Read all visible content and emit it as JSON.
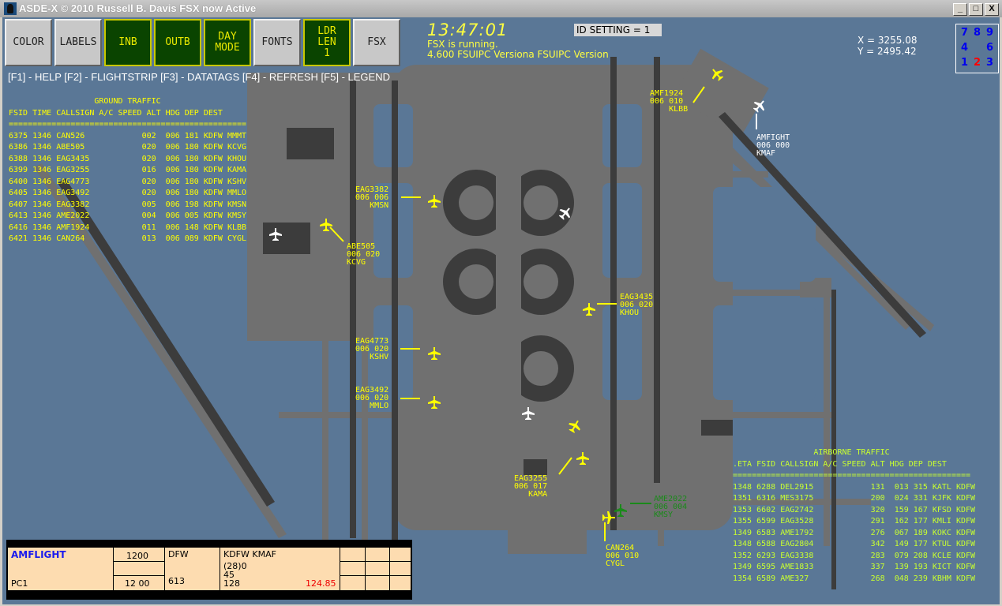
{
  "window": {
    "title": "ASDE-X © 2010 Russell B. Davis  FSX now Active",
    "controls": [
      "_",
      "□",
      "X"
    ]
  },
  "toolbar": {
    "buttons": [
      {
        "label": "COLOR",
        "style": "gray"
      },
      {
        "label": "LABELS",
        "style": "gray"
      },
      {
        "label": "INB",
        "style": "green"
      },
      {
        "label": "OUTB",
        "style": "green"
      },
      {
        "label": "DAY\nMODE",
        "style": "green"
      },
      {
        "label": "FONTS",
        "style": "gray"
      },
      {
        "label": "LDR\nLEN\n1",
        "style": "green"
      },
      {
        "label": "FSX",
        "style": "gray"
      }
    ]
  },
  "help_line": "[F1] - HELP [F2] - FLIGHTSTRIP [F3] - DATATAGS [F4] - REFRESH [F5] - LEGEND",
  "status": {
    "clock": "13:47:01",
    "fsx_running": "FSX is running.",
    "fsuipc_version": "4.600 FSUIPC Versiona FSUIPC Version",
    "id_setting": "ID SETTING = 1",
    "x_coord": "X = 3255.08",
    "y_coord": "Y = 2495.42"
  },
  "numpad": {
    "rows": [
      [
        "7",
        "8",
        "9"
      ],
      [
        "4",
        "",
        "6"
      ],
      [
        "1",
        "2",
        "3"
      ]
    ],
    "active": "2",
    "colors": {
      "normal": "#0000ee",
      "active": "#ff0000"
    }
  },
  "ground_traffic": {
    "title": "GROUND TRAFFIC",
    "columns": [
      "FSID",
      "TIME",
      "CALLSIGN",
      "A/C",
      "SPEED",
      "ALT",
      "HDG",
      "DEP",
      "DEST"
    ],
    "separator": "==================================================",
    "rows": [
      [
        "6375",
        "1346",
        "CAN526",
        "",
        "002",
        "006",
        "181",
        "KDFW",
        "MMMT"
      ],
      [
        "6386",
        "1346",
        "ABE505",
        "",
        "020",
        "006",
        "180",
        "KDFW",
        "KCVG"
      ],
      [
        "6388",
        "1346",
        "EAG3435",
        "",
        "020",
        "006",
        "180",
        "KDFW",
        "KHOU"
      ],
      [
        "6399",
        "1346",
        "EAG3255",
        "",
        "016",
        "006",
        "180",
        "KDFW",
        "KAMA"
      ],
      [
        "6400",
        "1346",
        "EAG4773",
        "",
        "020",
        "006",
        "180",
        "KDFW",
        "KSHV"
      ],
      [
        "6405",
        "1346",
        "EAG3492",
        "",
        "020",
        "006",
        "180",
        "KDFW",
        "MMLO"
      ],
      [
        "6407",
        "1346",
        "EAG3382",
        "",
        "005",
        "006",
        "198",
        "KDFW",
        "KMSN"
      ],
      [
        "6413",
        "1346",
        "AME2022",
        "",
        "004",
        "006",
        "005",
        "KDFW",
        "KMSY"
      ],
      [
        "6416",
        "1346",
        "AMF1924",
        "",
        "011",
        "006",
        "148",
        "KDFW",
        "KLBB"
      ],
      [
        "6421",
        "1346",
        "CAN264",
        "",
        "013",
        "006",
        "089",
        "KDFW",
        "CYGL"
      ]
    ]
  },
  "airborne_traffic": {
    "title": "AIRBORNE TRAFFIC",
    "columns": [
      ".ETA",
      "FSID",
      "CALLSIGN",
      "A/C",
      "SPEED",
      "ALT",
      "HDG",
      "DEP",
      "DEST"
    ],
    "separator": "==================================================",
    "rows": [
      [
        "1348",
        "6288",
        "DEL2915",
        "",
        "131",
        "013",
        "315",
        "KATL",
        "KDFW"
      ],
      [
        "1351",
        "6316",
        "MES3175",
        "",
        "200",
        "024",
        "331",
        "KJFK",
        "KDFW"
      ],
      [
        "1353",
        "6602",
        "EAG2742",
        "",
        "320",
        "159",
        "167",
        "KFSD",
        "KDFW"
      ],
      [
        "1355",
        "6599",
        "EAG3528",
        "",
        "291",
        "162",
        "177",
        "KMLI",
        "KDFW"
      ],
      [
        "1349",
        "6583",
        "AME1792",
        "",
        "276",
        "067",
        "189",
        "KOKC",
        "KDFW"
      ],
      [
        "1348",
        "6588",
        "EAG2804",
        "",
        "342",
        "149",
        "177",
        "KTUL",
        "KDFW"
      ],
      [
        "1352",
        "6293",
        "EAG3338",
        "",
        "283",
        "079",
        "208",
        "KCLE",
        "KDFW"
      ],
      [
        "1349",
        "6595",
        "AME1833",
        "",
        "337",
        "139",
        "193",
        "KICT",
        "KDFW"
      ],
      [
        "1354",
        "6589",
        "AME327",
        "",
        "268",
        "048",
        "239",
        "KBHM",
        "KDFW"
      ]
    ]
  },
  "datatags": [
    {
      "callsign": "AMF1924",
      "line2": "006 010",
      "dest": "KLBB",
      "color": "yellow"
    },
    {
      "callsign": "AMFIGHT",
      "line2": "006 000",
      "dest": "KMAF",
      "color": "white"
    },
    {
      "callsign": "EAG3382",
      "line2": "006 006",
      "dest": "KMSN",
      "color": "yellow"
    },
    {
      "callsign": "ABE505",
      "line2": "006 020",
      "dest": "KCVG",
      "color": "yellow"
    },
    {
      "callsign": "EAG3435",
      "line2": "006 020",
      "dest": "KHOU",
      "color": "yellow"
    },
    {
      "callsign": "EAG4773",
      "line2": "006 020",
      "dest": "KSHV",
      "color": "yellow"
    },
    {
      "callsign": "EAG3492",
      "line2": "006 020",
      "dest": "MMLO",
      "color": "yellow"
    },
    {
      "callsign": "EAG3255",
      "line2": "006 017",
      "dest": "KAMA",
      "color": "yellow"
    },
    {
      "callsign": "AME2022",
      "line2": "006 004",
      "dest": "KMSY",
      "color": "green"
    },
    {
      "callsign": "CAN264",
      "line2": "006 010",
      "dest": "CYGL",
      "color": "yellow"
    }
  ],
  "flight_strip": {
    "callsign": "AMFLIGHT",
    "aircraft": "PC1",
    "squawk": "1200",
    "time": "12 00",
    "airport": "DFW",
    "field_613": "613",
    "route": "KDFW KMAF",
    "alt_line": "(28)0",
    "line_45": "45",
    "line_128": "128",
    "frequency": "124.85"
  },
  "colors": {
    "background": "#5a7796",
    "taxiway": "#707070",
    "runway": "#3c3c3c",
    "ground_text": "#ffff00",
    "airborne_text": "#c8ff30"
  }
}
